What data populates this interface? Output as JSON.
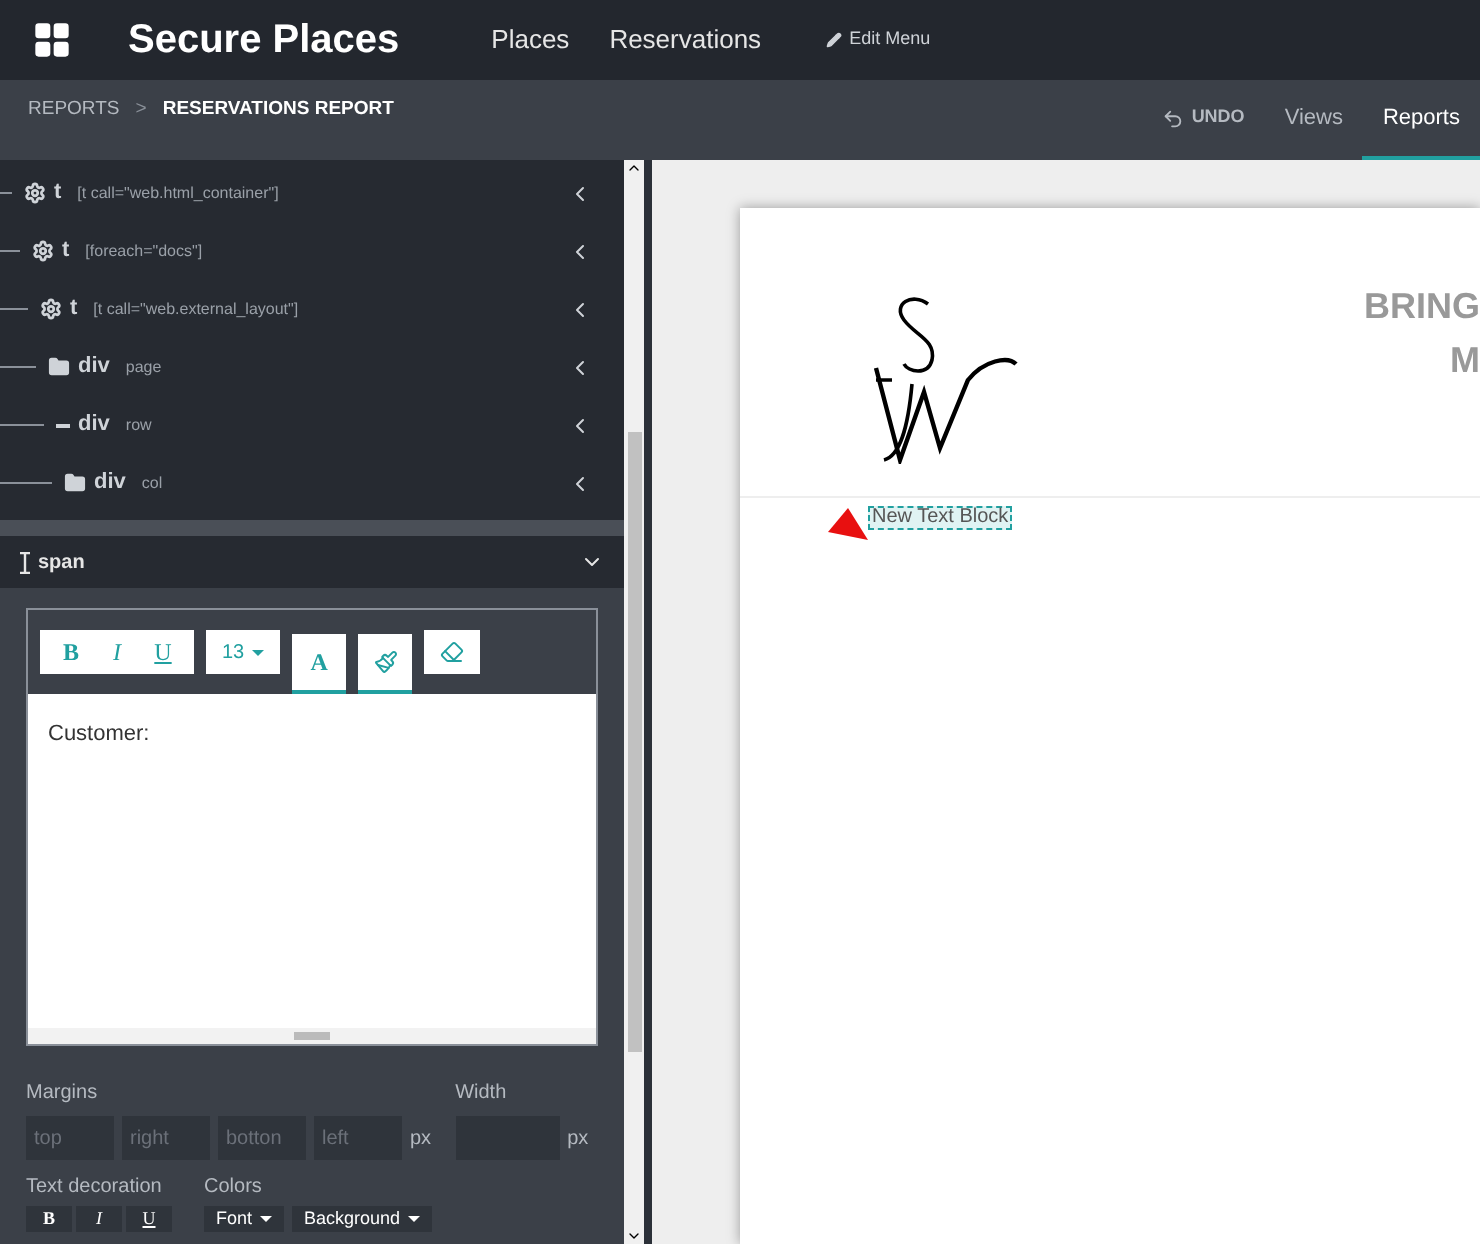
{
  "app": {
    "title": "Secure Places",
    "menu": [
      {
        "label": "Places"
      },
      {
        "label": "Reservations"
      }
    ],
    "edit_menu": "Edit Menu"
  },
  "breadcrumb": [
    {
      "label": "REPORTS",
      "selected": false
    },
    {
      "label": "RESERVATIONS REPORT",
      "selected": true
    }
  ],
  "breadcrumb_separator": ">",
  "actions": [
    {
      "label": "UNDO",
      "kind": "undo",
      "selected": false
    },
    {
      "label": "Views",
      "kind": "tab",
      "selected": false
    },
    {
      "label": "Reports",
      "kind": "tab",
      "selected": true
    }
  ],
  "tree": [
    {
      "kind": "template",
      "tag": "t",
      "attr": "[t call=\"web.html_container\"]",
      "children": [
        {
          "kind": "template",
          "tag": "t",
          "attr": "[foreach=\"docs\"]",
          "children": [
            {
              "kind": "template",
              "tag": "t",
              "attr": "[t call=\"web.external_layout\"]",
              "children": [
                {
                  "kind": "folder",
                  "tag": "div",
                  "attr": "page",
                  "children": [
                    {
                      "kind": "collapsed",
                      "tag": "div",
                      "attr": "row",
                      "children": [
                        {
                          "kind": "folder",
                          "tag": "div",
                          "attr": "col"
                        }
                      ]
                    }
                  ]
                }
              ]
            }
          ]
        }
      ]
    }
  ],
  "selected_node": {
    "tag": "span",
    "expanded": true
  },
  "editor": {
    "toolbar": [
      {
        "label": "B",
        "kind": "bold"
      },
      {
        "label": "I",
        "kind": "italic"
      },
      {
        "label": "U",
        "kind": "underline"
      }
    ],
    "font_size": "13",
    "font_color": "A",
    "content": "Customer:"
  },
  "margins": {
    "label": "Margins",
    "fields": [
      {
        "placeholder": "top"
      },
      {
        "placeholder": "right"
      },
      {
        "placeholder": "botton"
      },
      {
        "placeholder": "left"
      }
    ],
    "unit": "px"
  },
  "width": {
    "label": "Width",
    "unit": "px"
  },
  "text_decoration": {
    "label": "Text decoration",
    "buttons": [
      {
        "label": "B"
      },
      {
        "label": "I"
      },
      {
        "label": "U"
      }
    ]
  },
  "colors": {
    "label": "Colors",
    "buttons": [
      {
        "label": "Font"
      },
      {
        "label": "Background"
      }
    ]
  },
  "report": {
    "text_block": "New Text Block",
    "heading": "BRING",
    "heading_2": "M"
  }
}
